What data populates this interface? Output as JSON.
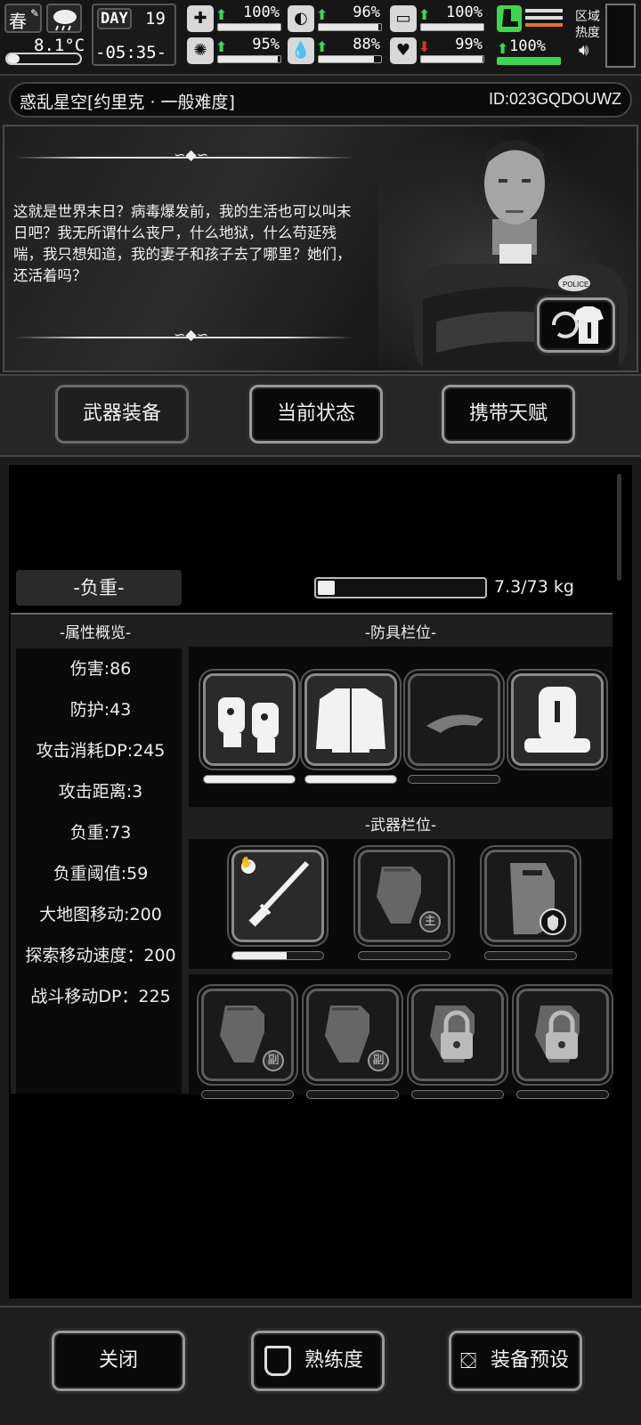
{
  "status": {
    "season": "春",
    "temperature": "8.1°C",
    "day_label": "DAY",
    "day": "19",
    "time": "-05:35-",
    "stats": [
      {
        "name": "health",
        "icon": "medkit-icon",
        "glyph": "✚",
        "trend": "up",
        "value": "100%",
        "fill": 100
      },
      {
        "name": "hunger",
        "icon": "stomach-icon",
        "glyph": "◐",
        "trend": "up",
        "value": "96%",
        "fill": 96
      },
      {
        "name": "medicine",
        "icon": "pill-icon",
        "glyph": "▭",
        "trend": "up",
        "value": "100%",
        "fill": 100
      },
      {
        "name": "sanity",
        "icon": "brain-icon",
        "glyph": "✺",
        "trend": "up",
        "value": "95%",
        "fill": 95
      },
      {
        "name": "thirst",
        "icon": "water-drop-icon",
        "glyph": "💧",
        "trend": "up",
        "value": "88%",
        "fill": 88
      },
      {
        "name": "mood",
        "icon": "heart-icon",
        "glyph": "♥",
        "trend": "down",
        "value": "99%",
        "fill": 99
      }
    ],
    "stamina": {
      "trend": "up",
      "value": "100%",
      "fill": 100
    },
    "zone_heat_label": "区域热度"
  },
  "title": {
    "save_name": "惑乱星空[约里克 · 一般难度]",
    "id": "ID:023GQDOUWZ"
  },
  "story": {
    "text": "这就是世界末日？病毒爆发前，我的生活也可以叫末日吧？我无所谓什么丧尸，什么地狱，什么苟延残喘，我只想知道，我的妻子和孩子去了哪里？她们，还活着吗？",
    "badge": "POLICE"
  },
  "tabs": [
    "武器装备",
    "当前状态",
    "携带天赋"
  ],
  "weight": {
    "label": "-负重-",
    "value": "7.3/73 kg",
    "fill": 0.1
  },
  "attributes": {
    "header": "-属性概览-",
    "items": [
      "伤害:86",
      "防护:43",
      "攻击消耗DP:245",
      "攻击距离:3",
      "负重:73",
      "负重阈值:59",
      "大地图移动:200",
      "探索移动速度：200",
      "战斗移动DP：225"
    ]
  },
  "armor": {
    "header": "-防具栏位-",
    "slots": [
      {
        "name": "gloves-icon",
        "durability": 1.0
      },
      {
        "name": "jacket-icon",
        "durability": 1.0
      },
      {
        "name": "cap-icon",
        "durability": 0.0
      },
      {
        "name": "backpack-icon",
        "durability": null
      }
    ]
  },
  "weapons": {
    "header": "-武器栏位-",
    "slots": [
      {
        "name": "katana-icon",
        "durability": 0.6
      },
      {
        "name": "fist-main-icon",
        "badge": "主",
        "durability": 0.0
      },
      {
        "name": "riot-shield-icon",
        "durability": 0.0
      },
      {
        "name": "fist-secondary-icon",
        "badge": "副",
        "durability": 0.0
      },
      {
        "name": "fist-secondary-icon",
        "badge": "副",
        "durability": 0.0
      },
      {
        "name": "locked-slot-icon",
        "durability": 0.0
      },
      {
        "name": "locked-slot-icon",
        "durability": 0.0
      }
    ]
  },
  "bottom": {
    "close": "关闭",
    "proficiency": "熟练度",
    "preset": "装备预设"
  }
}
